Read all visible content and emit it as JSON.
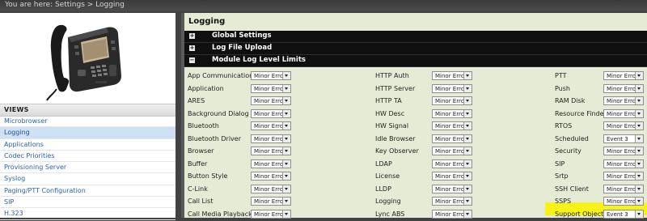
{
  "breadcrumb": "You are here: Settings > Logging",
  "sidebar": {
    "views_title": "VIEWS",
    "items": [
      {
        "label": "Microbrowser",
        "active": false
      },
      {
        "label": "Logging",
        "active": true
      },
      {
        "label": "Applications",
        "active": false
      },
      {
        "label": "Codec Priorities",
        "active": false
      },
      {
        "label": "Provisioning Server",
        "active": false
      },
      {
        "label": "Syslog",
        "active": false
      },
      {
        "label": "Paging/PTT Configuration",
        "active": false
      },
      {
        "label": "SIP",
        "active": false
      },
      {
        "label": "H.323",
        "active": false
      }
    ]
  },
  "main": {
    "title": "Logging",
    "sections": [
      {
        "label": "Global Settings",
        "toggle": "+"
      },
      {
        "label": "Log File Upload",
        "toggle": "+"
      },
      {
        "label": "Module Log Level Limits",
        "toggle": "−"
      }
    ],
    "columns": [
      [
        {
          "label": "App Communication",
          "value": "Minor Error"
        },
        {
          "label": "Application",
          "value": "Minor Error"
        },
        {
          "label": "ARES",
          "value": "Minor Error"
        },
        {
          "label": "Background Dialog",
          "value": "Minor Error"
        },
        {
          "label": "Bluetooth",
          "value": "Minor Error"
        },
        {
          "label": "Bluetooth Driver",
          "value": "Minor Error"
        },
        {
          "label": "Browser",
          "value": "Minor Error"
        },
        {
          "label": "Buffer",
          "value": "Minor Error"
        },
        {
          "label": "Button Style",
          "value": "Minor Error"
        },
        {
          "label": "C-Link",
          "value": "Minor Error"
        },
        {
          "label": "Call List",
          "value": "Minor Error"
        },
        {
          "label": "Call Media Playback",
          "value": "Minor Error"
        }
      ],
      [
        {
          "label": "HTTP Auth",
          "value": "Minor Error"
        },
        {
          "label": "HTTP Server",
          "value": "Minor Error"
        },
        {
          "label": "HTTP TA",
          "value": "Minor Error"
        },
        {
          "label": "HW Desc",
          "value": "Minor Error"
        },
        {
          "label": "HW Signal",
          "value": "Minor Error"
        },
        {
          "label": "Idle Browser",
          "value": "Minor Error"
        },
        {
          "label": "Key Observer",
          "value": "Minor Error"
        },
        {
          "label": "LDAP",
          "value": "Minor Error"
        },
        {
          "label": "License",
          "value": "Minor Error"
        },
        {
          "label": "LLDP",
          "value": "Minor Error"
        },
        {
          "label": "Logging",
          "value": "Minor Error"
        },
        {
          "label": "Lync ABS",
          "value": "Minor Error"
        }
      ],
      [
        {
          "label": "PTT",
          "value": "Minor Error"
        },
        {
          "label": "Push",
          "value": "Minor Error"
        },
        {
          "label": "RAM Disk",
          "value": "Minor Error"
        },
        {
          "label": "Resource Finder",
          "value": "Minor Error"
        },
        {
          "label": "RTOS",
          "value": "Minor Error"
        },
        {
          "label": "Scheduled",
          "value": "Event 3"
        },
        {
          "label": "Security",
          "value": "Minor Error"
        },
        {
          "label": "SIP",
          "value": "Minor Error"
        },
        {
          "label": "Srtp",
          "value": "Minor Error"
        },
        {
          "label": "SSH Client",
          "value": "Minor Error"
        },
        {
          "label": "SSPS",
          "value": "Minor Error"
        },
        {
          "label": "Support Objects",
          "value": "Event 3",
          "highlighted": true
        }
      ]
    ]
  },
  "colors": {
    "panel_bg": "#e6ebd6",
    "section_bar": "#0f0f0f",
    "link": "#2b62b0",
    "active_nav_bg": "#cfe2f5",
    "highlight": "#f7f31a"
  },
  "icons": [
    "desk-phone-icon",
    "expand-icon",
    "collapse-icon",
    "dropdown-arrow-icon"
  ]
}
